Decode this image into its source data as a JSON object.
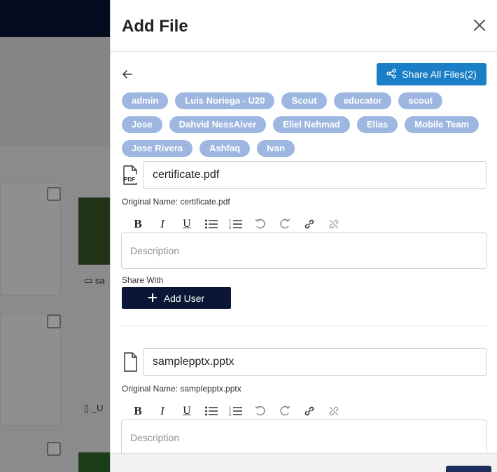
{
  "drawer": {
    "title": "Add File",
    "share_all_label": "Share All Files(2)"
  },
  "tags": [
    "admin",
    "Luis Noriega - U20",
    "Scout",
    "educator",
    "scout",
    "Jose",
    "Dahvid NessAiver",
    "Eliel Nehmad",
    "Elias",
    "Mobile Team",
    "Jose Rivera",
    "Ashfaq",
    "Ivan"
  ],
  "files": [
    {
      "name": "certificate.pdf",
      "original_name": "Original Name: certificate.pdf",
      "icon": "pdf-file-icon",
      "description_placeholder": "Description",
      "share_with_label": "Share With",
      "add_user_label": "Add User"
    },
    {
      "name": "samplepptx.pptx",
      "original_name": "Original Name: samplepptx.pptx",
      "icon": "file-icon",
      "description_placeholder": "Description"
    }
  ],
  "background": {
    "item1_label": "sa",
    "item2_label": "_U"
  }
}
